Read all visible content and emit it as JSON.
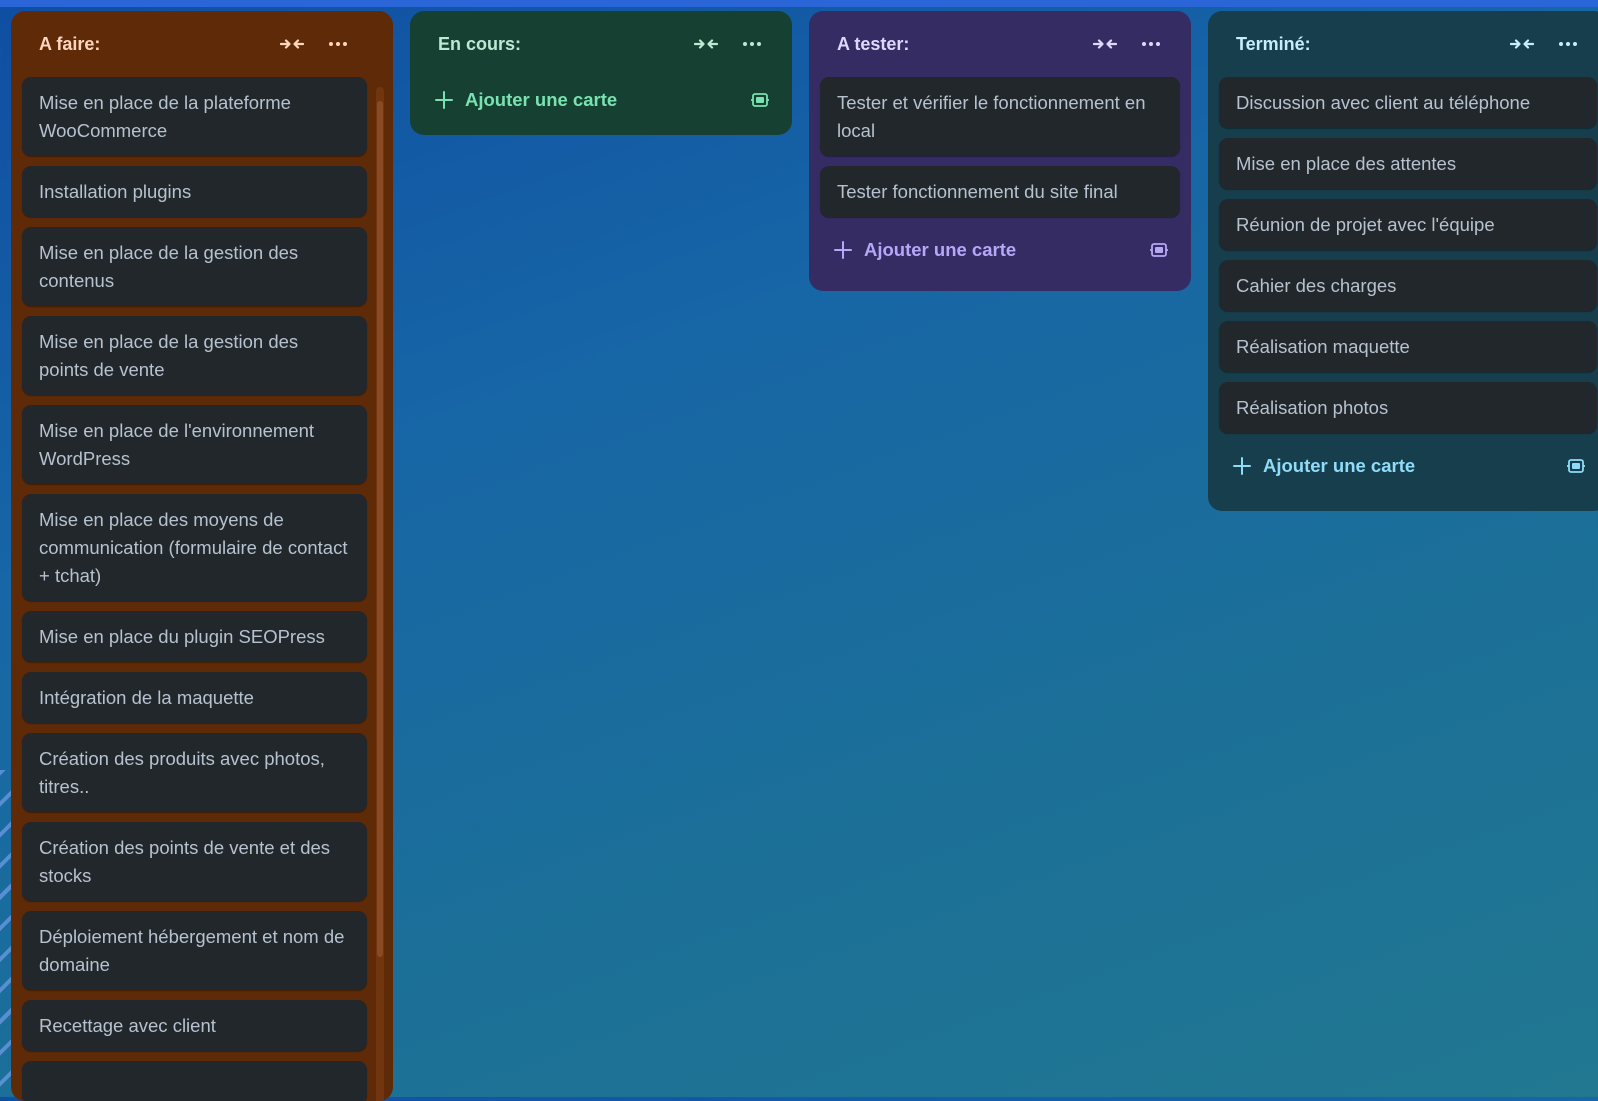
{
  "lists": [
    {
      "title": "A faire:",
      "cards": [
        "Mise en place de la plateforme WooCommerce",
        "Installation plugins",
        "Mise en place de la gestion des contenus",
        "Mise en place de la gestion des points de vente",
        "Mise en place de l'environnement WordPress",
        "Mise en place des moyens de communication (formulaire de contact + tchat)",
        "Mise en place du plugin SEOPress",
        "Intégration de la maquette",
        "Création des produits avec photos, titres..",
        "Création des points de vente et des stocks",
        "Déploiement hébergement et nom de domaine",
        "Recettage avec client"
      ],
      "color": "#5f2a08"
    },
    {
      "title": "En cours:",
      "cards": [],
      "add_label": "Ajouter une carte",
      "color": "#164132"
    },
    {
      "title": "A tester:",
      "cards": [
        "Tester et vérifier le fonctionnement en local",
        "Tester fonctionnement du site final"
      ],
      "add_label": "Ajouter une carte",
      "color": "#352c63"
    },
    {
      "title": "Terminé:",
      "cards": [
        "Discussion avec client au téléphone",
        "Mise en place des attentes",
        "Réunion de projet avec l'équipe",
        "Cahier des charges",
        "Réalisation maquette",
        "Réalisation photos"
      ],
      "add_label": "Ajouter une carte",
      "color": "#173e4c"
    }
  ],
  "icons": {
    "collapse": "collapse-arrows-icon",
    "more": "more-horizontal-icon",
    "add": "plus-icon",
    "template": "card-template-icon"
  }
}
